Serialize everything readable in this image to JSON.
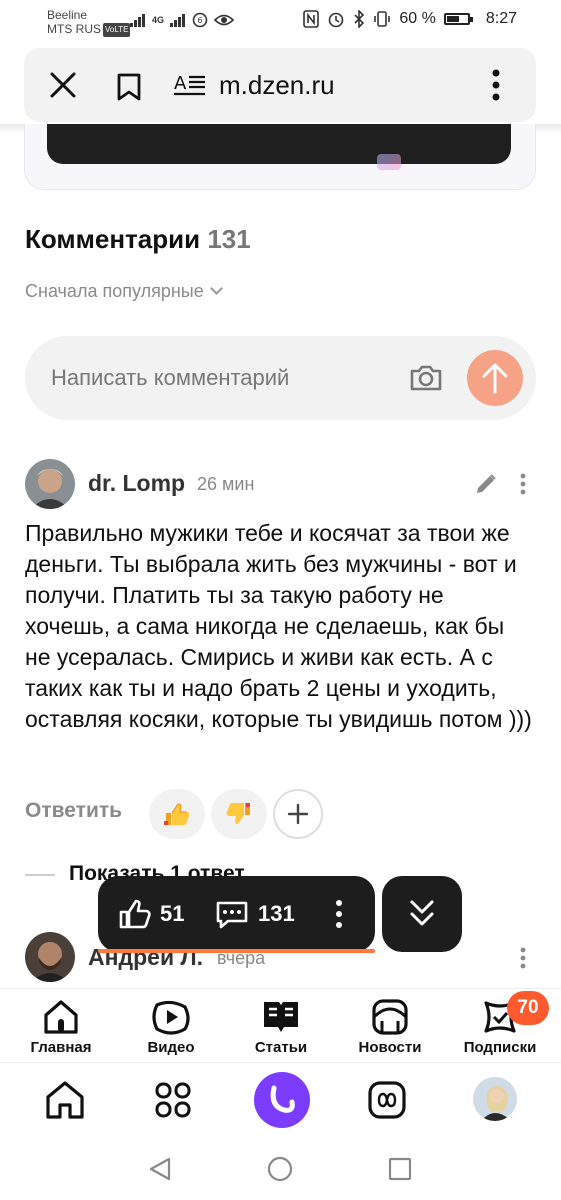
{
  "status_bar": {
    "carrier1": "Beeline",
    "carrier2": "MTS RUS",
    "volte": "VoLTE",
    "network": "4G",
    "battery": "60 %",
    "battery_level": 0.6,
    "time": "8:27"
  },
  "url_bar": {
    "url": "m.dzen.ru",
    "icons": [
      "close-icon",
      "bookmark-icon",
      "reader-mode-icon",
      "more-vertical-icon"
    ]
  },
  "comments": {
    "title": "Комментарии",
    "count": "131",
    "sort_label": "Сначала популярные",
    "input_placeholder": "Написать комментарий",
    "items": [
      {
        "author": "dr. Lomp",
        "time": "26 мин",
        "text": "Правильно мужики тебе и косячат за твои же деньги. Ты выбрала жить без мужчины - вот и получи. Платить ты за такую работу не хочешь, а сама никогда не сделаешь, как бы не усералась. Смирись и живи как есть. А с таких как ты и надо брать 2 цены и уходить, оставляя косяки, которые ты увидишь потом )))",
        "reply_label": "Ответить",
        "show_replies": "Показать 1 ответ"
      },
      {
        "author": "Андрей Л.",
        "time": "вчера"
      }
    ]
  },
  "floating_bar": {
    "likes": "51",
    "comments": "131"
  },
  "site_nav": {
    "items": [
      {
        "label": "Главная",
        "icon": "home-icon"
      },
      {
        "label": "Видео",
        "icon": "video-icon"
      },
      {
        "label": "Статьи",
        "icon": "articles-icon"
      },
      {
        "label": "Новости",
        "icon": "news-icon"
      },
      {
        "label": "Подписки",
        "icon": "subscriptions-icon"
      }
    ],
    "subscriptions_badge": "70"
  },
  "browser_bar": {
    "icons": [
      "home-icon",
      "apps-grid-icon",
      "alice-assistant-icon",
      "tabs-icon",
      "profile-avatar"
    ]
  },
  "colors": {
    "accent": "#ff5a2e",
    "send_button": "#f5a287",
    "floating_bar": "#1d1d1d",
    "alice": "#7c3cff"
  }
}
